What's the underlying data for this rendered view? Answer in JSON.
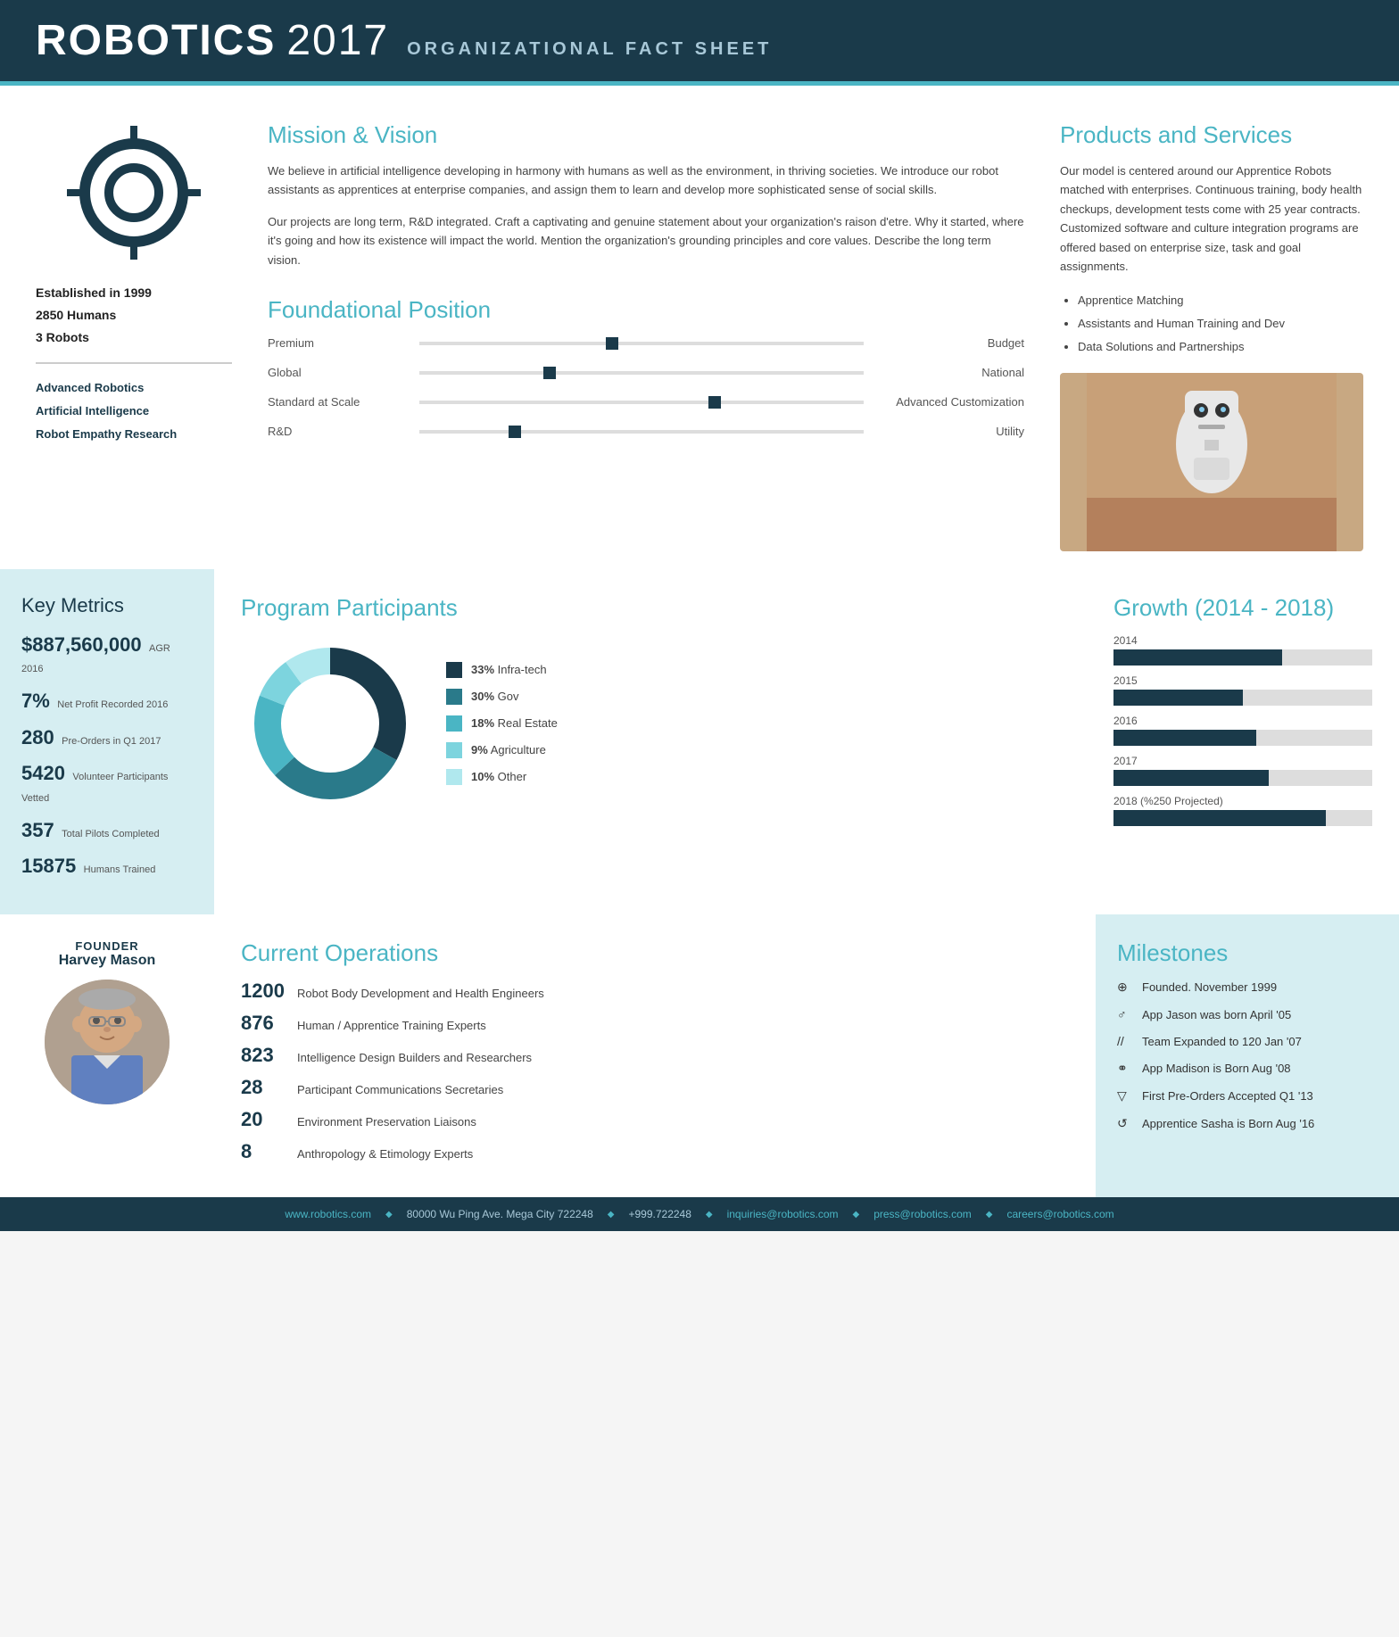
{
  "header": {
    "title_bold": "ROBOTICS",
    "title_year": "2017",
    "subtitle": "ORGANIZATIONAL FACT SHEET"
  },
  "left_col": {
    "established": "Established in 1999",
    "humans": "2850 Humans",
    "robots": "3 Robots",
    "expertise": [
      "Advanced Robotics",
      "Artificial Intelligence",
      "Robot Empathy Research"
    ]
  },
  "mission": {
    "title": "Mission & Vision",
    "para1": "We believe in artificial intelligence developing in harmony with humans as well as the environment, in thriving societies. We introduce our robot assistants as apprentices at enterprise companies, and assign them to learn and develop more sophisticated sense of social skills.",
    "para2": "Our projects are long term, R&D integrated. Craft a captivating and genuine statement about your organization's raison d'etre. Why it started, where it's going and how its existence will impact the world. Mention the organization's grounding principles and core values. Describe the long term vision."
  },
  "foundational": {
    "title": "Foundational Position",
    "rows": [
      {
        "left": "Premium",
        "right": "Budget",
        "dot_pct": 42
      },
      {
        "left": "Global",
        "right": "National",
        "dot_pct": 30
      },
      {
        "left": "Standard at Scale",
        "right": "Advanced Customization",
        "dot_pct": 68
      },
      {
        "left": "R&D",
        "right": "Utility",
        "dot_pct": 22
      }
    ]
  },
  "products": {
    "title": "Products and Services",
    "body": "Our model is centered around our Apprentice Robots matched with enterprises. Continuous training, body health checkups, development tests come with 25 year contracts. Customized software and culture integration programs are offered based on enterprise size, task and goal assignments.",
    "list": [
      "Apprentice Matching",
      "Assistants and Human Training and Dev",
      "Data Solutions and Partnerships"
    ]
  },
  "metrics": {
    "title": "Key Metrics",
    "items": [
      {
        "big": "$887,560,000",
        "small": "AGR 2016"
      },
      {
        "big": "7%",
        "small": "Net Profit Recorded 2016"
      },
      {
        "big": "280",
        "small": "Pre-Orders in Q1 2017"
      },
      {
        "big": "5420",
        "small": "Volunteer Participants Vetted"
      },
      {
        "big": "357",
        "small": "Total Pilots Completed"
      },
      {
        "big": "15875",
        "small": "Humans Trained"
      }
    ]
  },
  "program": {
    "title": "Program Participants",
    "segments": [
      {
        "color": "#1a3a4a",
        "pct": 33,
        "label": "Infra-tech"
      },
      {
        "color": "#2a7a8a",
        "pct": 30,
        "label": "Gov"
      },
      {
        "color": "#4ab5c4",
        "pct": 18,
        "label": "Real Estate"
      },
      {
        "color": "#7dd4de",
        "pct": 9,
        "label": "Agriculture"
      },
      {
        "color": "#b0e8ee",
        "pct": 10,
        "label": "Other"
      }
    ]
  },
  "growth": {
    "title": "Growth (2014 - 2018)",
    "bars": [
      {
        "year": "2014",
        "pct": 65,
        "projected": false
      },
      {
        "year": "2015",
        "pct": 50,
        "projected": false
      },
      {
        "year": "2016",
        "pct": 55,
        "projected": false
      },
      {
        "year": "2017",
        "pct": 60,
        "projected": false
      },
      {
        "year": "2018 (%250 Projected)",
        "pct": 82,
        "projected": true
      }
    ]
  },
  "founder": {
    "label": "FOUNDER",
    "name": "Harvey Mason"
  },
  "operations": {
    "title": "Current Operations",
    "items": [
      {
        "big": "1200",
        "text": "Robot Body Development and Health Engineers"
      },
      {
        "big": "876",
        "text": "Human / Apprentice Training Experts"
      },
      {
        "big": "823",
        "text": "Intelligence Design Builders and Researchers"
      },
      {
        "big": "28",
        "text": "Participant Communications Secretaries"
      },
      {
        "big": "20",
        "text": "Environment Preservation Liaisons"
      },
      {
        "big": "8",
        "text": "Anthropology & Etimology Experts"
      }
    ]
  },
  "milestones": {
    "title": "Milestones",
    "items": [
      {
        "icon": "⊕",
        "text": "Founded. November 1999"
      },
      {
        "icon": "♂",
        "text": "App Jason was born April '05"
      },
      {
        "icon": "//",
        "text": "Team Expanded to 120 Jan '07"
      },
      {
        "icon": "⚭",
        "text": "App Madison is Born Aug '08"
      },
      {
        "icon": "▽",
        "text": "First Pre-Orders Accepted Q1 '13"
      },
      {
        "icon": "↺",
        "text": "Apprentice Sasha is Born Aug '16"
      }
    ]
  },
  "footer": {
    "website": "www.robotics.com",
    "address": "80000 Wu Ping Ave. Mega City 722248",
    "phone": "+999.722248",
    "email1": "inquiries@robotics.com",
    "email2": "press@robotics.com",
    "email3": "careers@robotics.com"
  }
}
